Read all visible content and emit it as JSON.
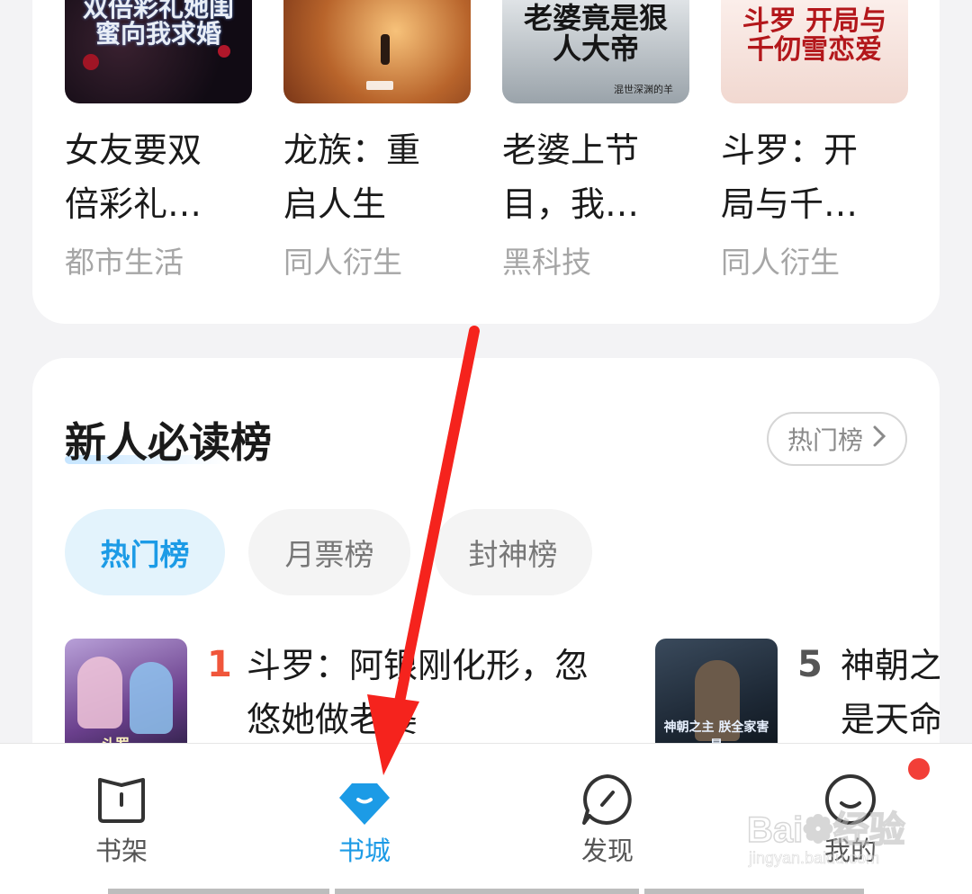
{
  "books": [
    {
      "title_line1": "女友要双",
      "title_line2": "倍彩礼…",
      "category": "都市生活",
      "cover_text": "双倍彩礼她闺蜜向我求婚"
    },
    {
      "title_line1": "龙族：重",
      "title_line2": "启人生",
      "category": "同人衍生",
      "cover_text": ""
    },
    {
      "title_line1": "老婆上节",
      "title_line2": "目，我…",
      "category": "黑科技",
      "cover_text": "老婆竟是狠人大帝",
      "cover_sub": "混世深渊的羊"
    },
    {
      "title_line1": "斗罗：开",
      "title_line2": "局与千…",
      "category": "同人衍生",
      "cover_text": "斗罗 开局与千仞雪恋爱"
    }
  ],
  "ranking": {
    "title": "新人必读榜",
    "more_label": "热门榜",
    "tabs": [
      "热门榜",
      "月票榜",
      "封神榜"
    ],
    "active_tab": 0,
    "items": [
      {
        "rank": "1",
        "line1": "斗罗：阿银刚化形，忽",
        "line2": "悠她做老婆",
        "cover_text": "斗罗"
      },
      {
        "rank": "5",
        "line1": "神朝之",
        "line2": "是天命",
        "cover_text": "神朝之主 朕全家害是"
      }
    ]
  },
  "nav": {
    "items": [
      {
        "label": "书架",
        "icon": "bookshelf-icon"
      },
      {
        "label": "书城",
        "icon": "bookstore-icon"
      },
      {
        "label": "发现",
        "icon": "compass-icon"
      },
      {
        "label": "我的",
        "icon": "profile-icon"
      }
    ],
    "active": 1
  },
  "watermark": {
    "line1": "Bai",
    "line2": "经验",
    "line3": "jingyan.baidu.com"
  },
  "colors": {
    "accent": "#1c9be6",
    "rank_top": "#f0563b",
    "rank_other": "#555555",
    "badge": "#f23f38",
    "arrow": "#f5231d"
  }
}
